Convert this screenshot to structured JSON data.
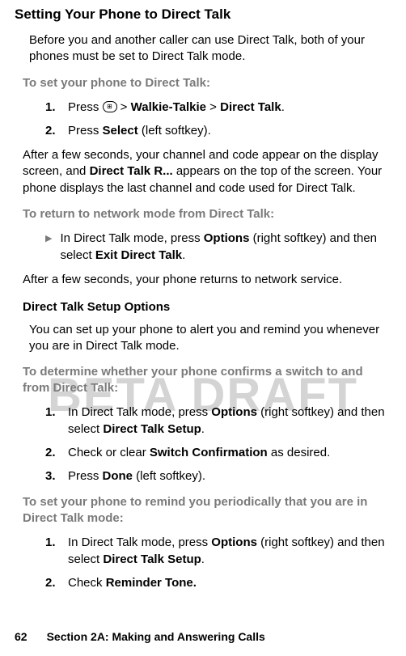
{
  "watermark": "BETA DRAFT",
  "heading": "Setting Your Phone to Direct Talk",
  "intro": "Before you and another caller can use Direct Talk, both of your phones must be set to Direct Talk mode.",
  "proc1_heading": "To set your phone to Direct Talk:",
  "step1_1_prefix": "Press ",
  "step1_1_icon": "⊞",
  "step1_1_sep1": " > ",
  "step1_1_bold1": "Walkie-Talkie",
  "step1_1_sep2": " > ",
  "step1_1_bold2": "Direct Talk",
  "step1_1_suffix": ".",
  "step1_2_prefix": "Press ",
  "step1_2_bold": "Select",
  "step1_2_suffix": " (left softkey).",
  "para_after1_p1": "After a few seconds, your channel and code appear on the display screen, and ",
  "para_after1_bold": "Direct Talk R...",
  "para_after1_p2": " appears on the top of the screen. Your phone displays the last channel and code used for Direct Talk.",
  "proc2_heading": "To return to network mode from Direct Talk:",
  "bullet2_prefix": "In Direct Talk mode, press ",
  "bullet2_bold1": "Options",
  "bullet2_mid": " (right softkey) and then select ",
  "bullet2_bold2": "Exit Direct Talk",
  "bullet2_suffix": ".",
  "para_after2": "After a few seconds, your phone returns to network service.",
  "sub_heading": "Direct Talk Setup Options",
  "sub_intro": "You can set up your phone to alert you and remind you whenever you are in Direct Talk mode.",
  "proc3_heading": "To determine whether your phone confirms a switch to and from Direct Talk:",
  "step3_1_prefix": "In Direct Talk mode, press ",
  "step3_1_bold1": "Options",
  "step3_1_mid": " (right softkey) and then select ",
  "step3_1_bold2": "Direct Talk Setup",
  "step3_1_suffix": ".",
  "step3_2_prefix": "Check or clear ",
  "step3_2_bold": "Switch Confirmation",
  "step3_2_suffix": " as desired.",
  "step3_3_prefix": "Press ",
  "step3_3_bold": "Done",
  "step3_3_suffix": " (left softkey).",
  "proc4_heading": "To set your phone to remind you periodically that you are in Direct Talk mode:",
  "step4_1_prefix": "In Direct Talk mode, press ",
  "step4_1_bold1": "Options",
  "step4_1_mid": " (right softkey) and then select ",
  "step4_1_bold2": "Direct Talk Setup",
  "step4_1_suffix": ".",
  "step4_2_prefix": "Check ",
  "step4_2_bold": "Reminder Tone.",
  "footer_page": "62",
  "footer_section": "Section 2A: Making and Answering Calls"
}
